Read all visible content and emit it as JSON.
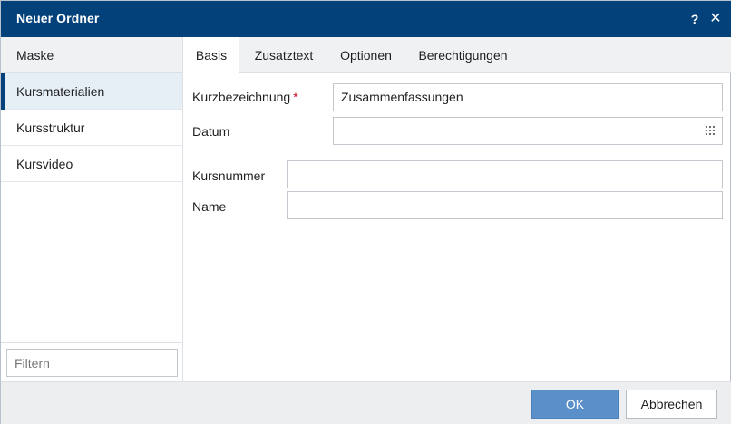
{
  "dialog": {
    "title": "Neuer Ordner",
    "help_label": "?",
    "close_label": "✕"
  },
  "sidebar": {
    "header": "Maske",
    "items": [
      {
        "label": "Kursmaterialien",
        "active": true
      },
      {
        "label": "Kursstruktur",
        "active": false
      },
      {
        "label": "Kursvideo",
        "active": false
      }
    ],
    "filter_placeholder": "Filtern"
  },
  "tabs": [
    {
      "label": "Basis",
      "active": true
    },
    {
      "label": "Zusatztext",
      "active": false
    },
    {
      "label": "Optionen",
      "active": false
    },
    {
      "label": "Berechtigungen",
      "active": false
    }
  ],
  "form": {
    "kurzbezeichnung": {
      "label": "Kurzbezeichnung",
      "required_mark": "*",
      "value": "Zusammenfassungen"
    },
    "datum": {
      "label": "Datum",
      "value": ""
    },
    "kursnummer": {
      "label": "Kursnummer",
      "value": ""
    },
    "name": {
      "label": "Name",
      "value": ""
    }
  },
  "footer": {
    "ok_label": "OK",
    "cancel_label": "Abbrechen"
  },
  "colors": {
    "titlebar": "#03417a",
    "ok_button": "#5b8fc9",
    "required": "#d0021b"
  },
  "icons": {
    "datum_picker": "calendar-grid-icon"
  }
}
